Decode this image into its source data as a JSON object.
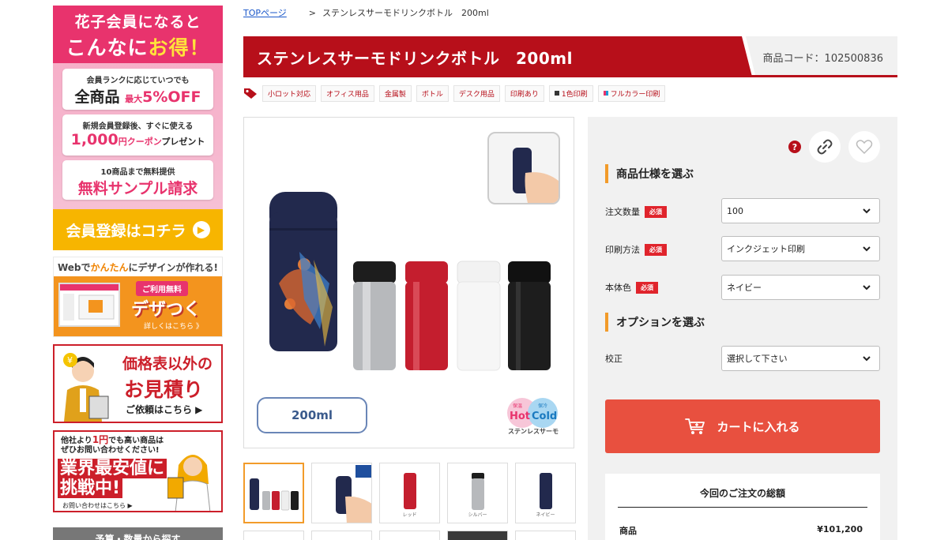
{
  "sidebar": {
    "member_banner": {
      "head_line1": "花子会員になると",
      "head_line2_a": "こんなに",
      "head_line2_b": "お得！",
      "card1_small": "会員ランクに応じていつでも",
      "card1_big_a": "全商品",
      "card1_big_b": "最大",
      "card1_big_c": "5%OFF",
      "card2_small": "新規会員登録後、すぐに使える",
      "card2_big_a": "1,000",
      "card2_big_b": "円クーポン",
      "card2_big_c": "プレゼント",
      "card3_small": "10商品まで無料提供",
      "card3_big": "無料サンプル請求",
      "cta": "会員登録はコチラ"
    },
    "design_banner": {
      "top_a": "Webで",
      "top_b": "かんたん",
      "top_c": "にデザインが作れる!",
      "free": "ご利用無料",
      "logo": "デザつく",
      "more": "詳しくはこちら 》"
    },
    "quote_banner": {
      "line1": "価格表以外の",
      "line2": "お見積り",
      "line3": "ご依頼はこちら ▶"
    },
    "cheap_banner": {
      "top1": "他社より",
      "top1_red": "1円",
      "top1_b": "でも高い商品は",
      "top2": "ぜひお問い合わせください!",
      "main1": "業界最安値に",
      "main2": "挑戦中!",
      "small": "お問い合わせはこちら ▶"
    },
    "more_label": "予算・数量から探す"
  },
  "breadcrumb": {
    "home": "TOPページ",
    "separator": ">",
    "current": "ステンレスサーモドリンクボトル　200ml"
  },
  "product": {
    "title": "ステンレスサーモドリンクボトル　200ml",
    "code_label": "商品コード：",
    "code": "102500836",
    "tags": [
      "小ロット対応",
      "オフィス用品",
      "金属製",
      "ボトル",
      "デスク用品",
      "印刷あり",
      "1色印刷",
      "フルカラー印刷"
    ],
    "size_label": "200ml",
    "hot_label": "Hot",
    "cold_label": "Cold",
    "hot_small": "保温",
    "cold_small": "保冷",
    "hotcold_caption": "ステンレスサーモ",
    "thumb_captions": [
      "",
      "",
      "レッド",
      "シルバー",
      "ネイビー"
    ]
  },
  "colors": {
    "brand_red": "#b70f1a",
    "accent_orange": "#f29b2a",
    "cart_red": "#e8503f",
    "required_red": "#e0242c",
    "navy": "#22294d",
    "silver": "#b7b9bc",
    "red_bottle": "#c41e2e",
    "white_bottle": "#f2f2f2",
    "black_bottle": "#1d1d1d"
  },
  "spec": {
    "section1": "商品仕様を選ぶ",
    "required": "必須",
    "quantity_label": "注文数量",
    "quantity_value": "100",
    "print_label": "印刷方法",
    "print_value": "インクジェット印刷",
    "body_color_label": "本体色",
    "body_color_value": "ネイビー",
    "section2": "オプションを選ぶ",
    "proof_label": "校正",
    "proof_value": "選択して下さい",
    "cart_label": "カートに入れる",
    "total_title": "今回のご注文の総額",
    "total_item_label": "商品",
    "total_item_value": "¥101,200"
  },
  "icons": {
    "help": "?",
    "tag": "tag-icon",
    "link": "link-icon",
    "favorite": "heart-icon",
    "cart": "cart-icon",
    "chevron": "chevron-down-icon"
  }
}
